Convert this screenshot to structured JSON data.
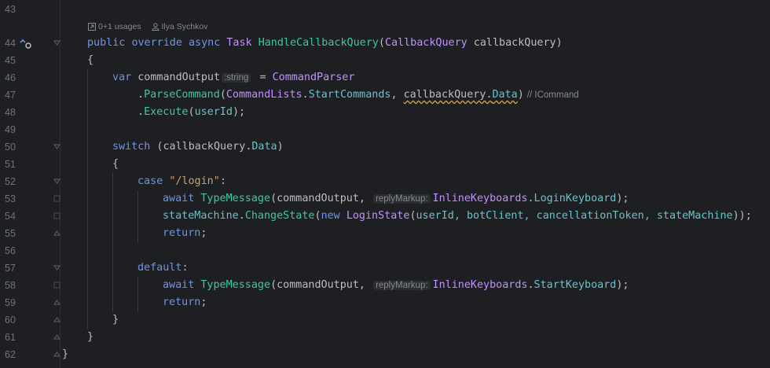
{
  "code_lens": {
    "usages": "0+1 usages",
    "author": "Ilya Sychkov"
  },
  "lines": [
    {
      "n": "43"
    },
    {
      "n": "44"
    },
    {
      "n": "45"
    },
    {
      "n": "46"
    },
    {
      "n": "47"
    },
    {
      "n": "48"
    },
    {
      "n": "49"
    },
    {
      "n": "50"
    },
    {
      "n": "51"
    },
    {
      "n": "52"
    },
    {
      "n": "53"
    },
    {
      "n": "54"
    },
    {
      "n": "55"
    },
    {
      "n": "56"
    },
    {
      "n": "57"
    },
    {
      "n": "58"
    },
    {
      "n": "59"
    },
    {
      "n": "60"
    },
    {
      "n": "61"
    },
    {
      "n": "62"
    }
  ],
  "tokens": {
    "public": "public",
    "override": "override",
    "async": "async",
    "task": "Task",
    "method": "HandleCallbackQuery",
    "paren_open": "(",
    "cbtype": "CallbackQuery",
    "param": " callbackQuery",
    "paren_close": ")",
    "brace_open": "{",
    "brace_close": "}",
    "var": "var",
    "cmdout": " commandOutput",
    "hint_string": ":string",
    "eq": " = ",
    "cmdparser": "CommandParser",
    "dot": ".",
    "parse": "ParseCommand",
    "cmdlists": "CommandLists",
    "startcmds": "StartCommands",
    "comma": ", ",
    "cbq": "callbackQuery",
    "data": "Data",
    "close_paren": ")",
    "comment_icmd": "// ICommand",
    "execute": "Execute",
    "userid": "userId",
    "close_semi": ");",
    "switch": "switch",
    "switch_open": " (",
    "switch_close": ")",
    "case": "case",
    "login_str": "\"/login\"",
    "colon": ":",
    "await": "await",
    "typemsg": "TypeMessage",
    "cmdout_arg": "commandOutput, ",
    "hint_reply": "replyMarkup:",
    "inlinekb": "InlineKeyboards",
    "loginkb": "LoginKeyboard",
    "startkb": "StartKeyboard",
    "statemachine": "stateMachine",
    "changestate": "ChangeState",
    "new": "new",
    "loginstate": "LoginState",
    "args": "userId, botClient, cancellationToken, stateMachine",
    "close_dbl": "));",
    "return": "return",
    "semi": ";",
    "default": "default"
  }
}
